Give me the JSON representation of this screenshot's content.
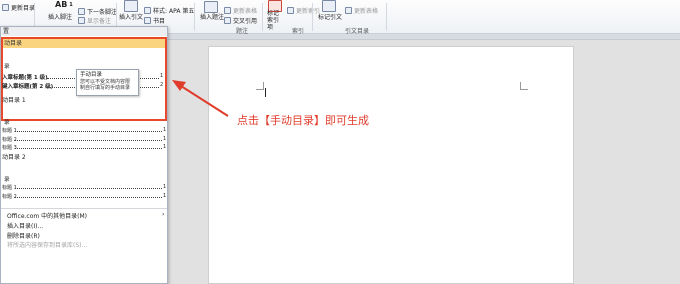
{
  "ribbon": {
    "update_toc": "更新目录",
    "insert_footnote": "插入脚注",
    "next_footnote": "下一条脚注",
    "show_notes": "显示备注",
    "insert_citation": "插入引文",
    "style_label": "样式:",
    "style_value": "APA 第五",
    "bibliography": "书目",
    "insert_caption": "插入题注",
    "update_table": "更新表格",
    "cross_reference": "交叉引用",
    "mark_entry": "标记索引项",
    "mark_citation": "标记引文",
    "update_index": "更新索引",
    "update_toa": "更新表格",
    "groups": {
      "caption": "题注",
      "index": "索引",
      "toa": "引文目录"
    },
    "ab_label": "AB",
    "ab_superscript": "1"
  },
  "dropdown": {
    "header": "置",
    "manual": {
      "title": "动目录",
      "heading": "录",
      "line1": "入章标题(第 1 级)",
      "line2": "键入章标题(第 2 级)",
      "page1": "1",
      "page2": "2"
    },
    "auto1": {
      "title": "动目录 1",
      "heading": "录",
      "lines": [
        "标题 1",
        "标题 2",
        "标题 3"
      ],
      "pages": [
        "1",
        "1",
        "1"
      ]
    },
    "auto2": {
      "title": "动目录 2",
      "heading": "录",
      "lines": [
        "标题 1",
        "标题 2"
      ],
      "pages": [
        "1",
        "1"
      ]
    },
    "menu": {
      "more_online": "Office.com 中的其他目录(M)",
      "insert_toc": "插入目录(I)...",
      "remove_toc": "删除目录(R)",
      "save_selection": "将所选内容保存到目录库(S)..."
    },
    "tooltip": {
      "title": "手动目录",
      "desc1": "您可以不受文档内容限",
      "desc2": "制自行填写的手动目录"
    }
  },
  "annotation": "点击【手动目录】即可生成",
  "colors": {
    "accent": "#e03c2b",
    "highlight": "#fbd480"
  }
}
